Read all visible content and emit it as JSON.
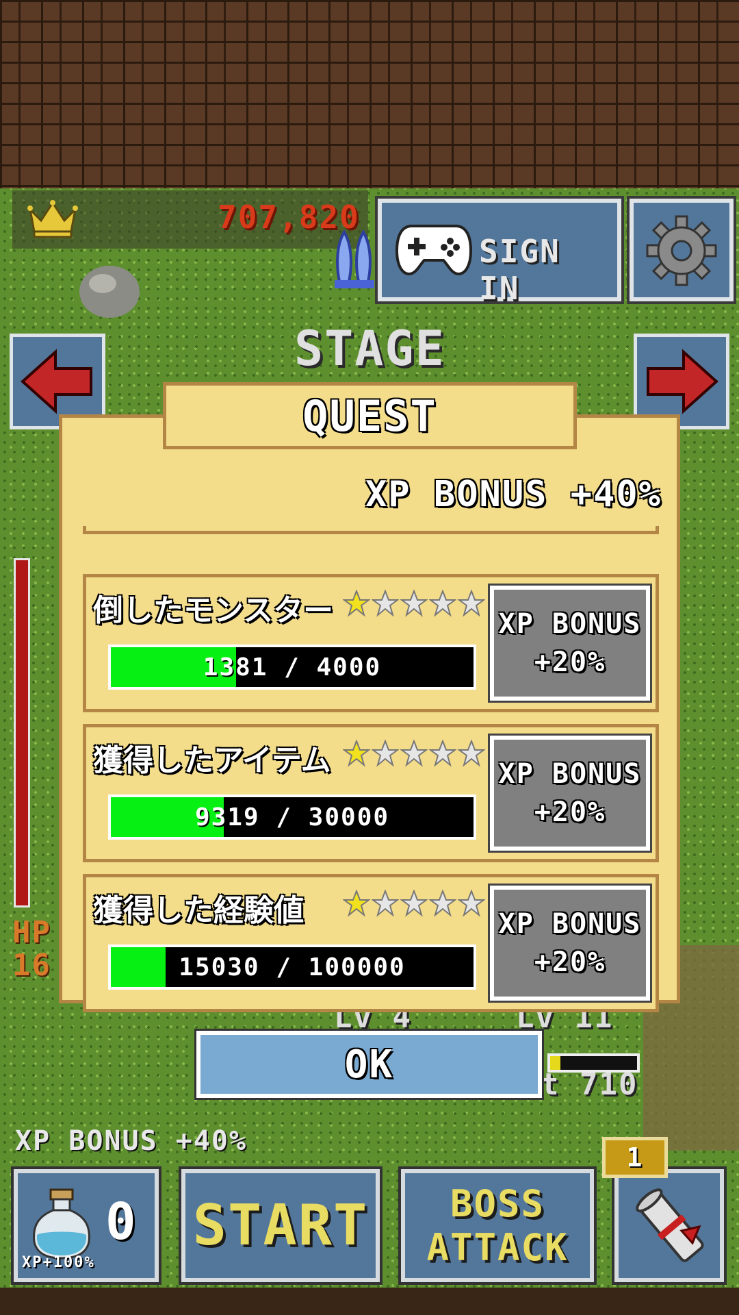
{
  "top_hud": {
    "score": "707,820",
    "sign_in_label": "SIGN IN"
  },
  "stage": {
    "title": "STAGE"
  },
  "player": {
    "hp_label": "HP",
    "hp_value": "16"
  },
  "field_text": {
    "lv_left": "Lv 4",
    "lv_right": "Lv 11",
    "stat_value": "t 710",
    "mini_bar_fill": 0.12
  },
  "quest": {
    "title": "QUEST",
    "total_bonus": "XP BONUS +40%",
    "rows": [
      {
        "name": "倒したモンスター",
        "stars_filled": 1,
        "stars_total": 5,
        "current": 1381,
        "target": 4000,
        "progress_text": "1381 / 4000",
        "bonus_line1": "XP BONUS",
        "bonus_line2": "+20%"
      },
      {
        "name": "獲得したアイテム",
        "stars_filled": 1,
        "stars_total": 5,
        "current": 9319,
        "target": 30000,
        "progress_text": "9319 / 30000",
        "bonus_line1": "XP BONUS",
        "bonus_line2": "+20%"
      },
      {
        "name": "獲得した経験値",
        "stars_filled": 1,
        "stars_total": 5,
        "current": 15030,
        "target": 100000,
        "progress_text": "15030 / 100000",
        "bonus_line1": "XP BONUS",
        "bonus_line2": "+20%"
      }
    ],
    "ok_label": "OK"
  },
  "bottom_hud": {
    "bonus_text": "XP BONUS +40%",
    "potion_count": "0",
    "potion_bonus": "XP+100%",
    "start_label": "START",
    "boss_line1": "BOSS",
    "boss_line2": "ATTACK",
    "scroll_badge": "1"
  },
  "colors": {
    "score_red": "#d83a1a",
    "panel_cream": "#f3dc8a",
    "panel_border": "#b38646",
    "progress_green": "#06f014",
    "button_blue": "#53779b",
    "ok_blue": "#7aa9d2",
    "start_yellow": "#e9dc62",
    "star_gold": "#f2e21e",
    "star_empty": "#e6e6e6"
  },
  "icons": {
    "crown": "crown-icon",
    "rocket": "rocket-icon",
    "gamepad": "gamepad-icon",
    "gear": "gear-icon",
    "arrow_left": "arrow-left-icon",
    "arrow_right": "arrow-right-icon",
    "potion": "potion-icon",
    "scroll": "scroll-icon",
    "star": "star-icon"
  }
}
